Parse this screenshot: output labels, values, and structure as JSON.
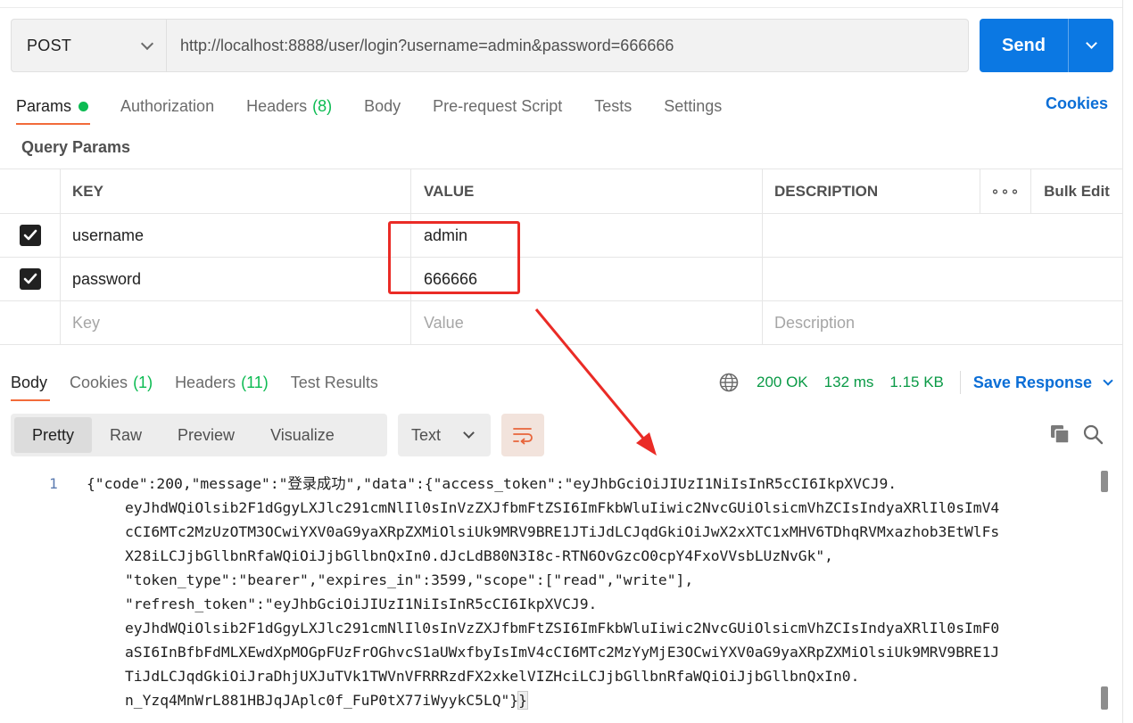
{
  "request": {
    "method": "POST",
    "url": "http://localhost:8888/user/login?username=admin&password=666666",
    "send_label": "Send"
  },
  "tabs": {
    "params": "Params",
    "authorization": "Authorization",
    "headers": "Headers",
    "headers_count": "(8)",
    "body": "Body",
    "prerequest": "Pre-request Script",
    "tests": "Tests",
    "settings": "Settings",
    "cookies": "Cookies"
  },
  "query_params": {
    "title": "Query Params",
    "columns": {
      "key": "KEY",
      "value": "VALUE",
      "description": "DESCRIPTION",
      "bulk_edit": "Bulk Edit"
    },
    "rows": [
      {
        "key": "username",
        "value": "admin",
        "checked": true
      },
      {
        "key": "password",
        "value": "666666",
        "checked": true
      }
    ],
    "placeholders": {
      "key": "Key",
      "value": "Value",
      "description": "Description"
    }
  },
  "response": {
    "tabs": {
      "body": "Body",
      "cookies": "Cookies",
      "cookies_count": "(1)",
      "headers": "Headers",
      "headers_count": "(11)",
      "test_results": "Test Results"
    },
    "status": "200 OK",
    "time": "132 ms",
    "size": "1.15 KB",
    "save": "Save Response",
    "view_modes": [
      "Pretty",
      "Raw",
      "Preview",
      "Visualize"
    ],
    "format": "Text",
    "line_number": "1",
    "code": [
      "{\"code\":200,\"message\":\"登录成功\",\"data\":{\"access_token\":\"eyJhbGciOiJIUzI1NiIsInR5cCI6IkpXVCJ9.",
      "eyJhdWQiOlsib2F1dGgyLXJlc291cmNlIl0sInVzZXJfbmFtZSI6ImFkbWluIiwic2NvcGUiOlsicmVhZCIsIndyaXRlIl0sImV4",
      "cCI6MTc2MzUzOTM3OCwiYXV0aG9yaXRpZXMiOlsiUk9MRV9BRE1JTiJdLCJqdGkiOiJwX2xXTC1xMHV6TDhqRVMxazhob3EtWlFs",
      "X28iLCJjbGllbnRfaWQiOiJjbGllbnQxIn0.dJcLdB80N3I8c-RTN6OvGzcO0cpY4FxoVVsbLUzNvGk\",",
      "\"token_type\":\"bearer\",\"expires_in\":3599,\"scope\":[\"read\",\"write\"],",
      "\"refresh_token\":\"eyJhbGciOiJIUzI1NiIsInR5cCI6IkpXVCJ9.",
      "eyJhdWQiOlsib2F1dGgyLXJlc291cmNlIl0sInVzZXJfbmFtZSI6ImFkbWluIiwic2NvcGUiOlsicmVhZCIsIndyaXRlIl0sImF0",
      "aSI6InBfbFdMLXEwdXpMOGpFUzFrOGhvcS1aUWxfbyIsImV4cCI6MTc2MzYyMjE3OCwiYXV0aG9yaXRpZXMiOlsiUk9MRV9BRE1J",
      "TiJdLCJqdGkiOiJraDhjUXJuTVk1TWVnVFRRRzdFX2xkelVIZHciLCJjbGllbnRfaWQiOiJjbGllbnQxIn0.",
      "n_Yzq4MnWrL881HBJqJAplc0f_FuP0tX77iWyykC5LQ\"}"
    ],
    "closing_brace": "}"
  },
  "annotation_color": "#ea2b26"
}
